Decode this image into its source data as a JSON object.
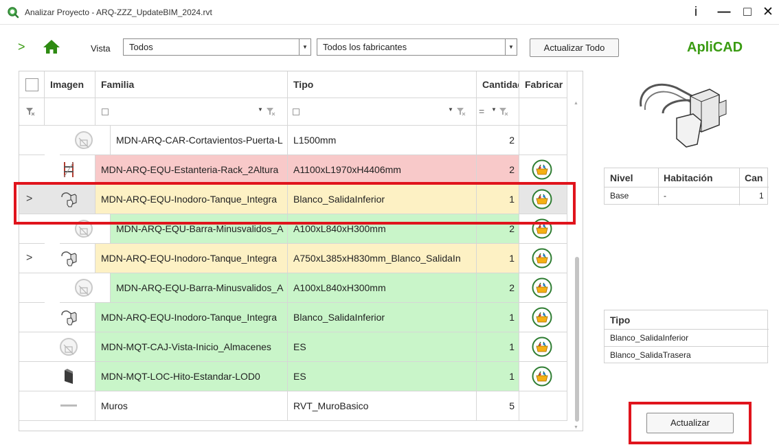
{
  "window": {
    "title": "Analizar Proyecto - ARQ-ZZZ_UpdateBIM_2024.rvt",
    "info_glyph": "i",
    "minimize_glyph": "—",
    "maximize_glyph": "□",
    "close_glyph": "✕"
  },
  "toolbar": {
    "expand_glyph": ">",
    "vista_label": "Vista",
    "vista_value": "Todos",
    "fabricantes_value": "Todos los fabricantes",
    "update_all_label": "Actualizar Todo",
    "brand": "ApliCAD",
    "accent": "#3a9b12"
  },
  "grid": {
    "columns": [
      "Imagen",
      "Familia",
      "Tipo",
      "Cantidad",
      "Fabricar"
    ],
    "filter_eq": "=",
    "rows": [
      {
        "familia": "MDN-ARQ-CAR-Cortavientos-Puerta-L",
        "tipo": "L1500mm",
        "cantidad": "2",
        "status": "none",
        "image": "no-image-icon",
        "indent": true,
        "fabricar": false
      },
      {
        "familia": "MDN-ARQ-EQU-Estanteria-Rack_2Altura",
        "tipo": "A1100xL1970xH4406mm",
        "cantidad": "2",
        "status": "red",
        "image": "rack-thumbnail",
        "indent": false,
        "fabricar": true
      },
      {
        "familia": "MDN-ARQ-EQU-Inodoro-Tanque_Integra",
        "tipo": "Blanco_SalidaInferior",
        "cantidad": "1",
        "status": "yellow",
        "image": "toilet-thumbnail",
        "indent": false,
        "expander": true,
        "selected": true,
        "fabricar": true
      },
      {
        "familia": "MDN-ARQ-EQU-Barra-Minusvalidos_A",
        "tipo": "A100xL840xH300mm",
        "cantidad": "2",
        "status": "green",
        "image": "no-image-icon",
        "indent": true,
        "fabricar": true
      },
      {
        "familia": "MDN-ARQ-EQU-Inodoro-Tanque_Integra",
        "tipo": "A750xL385xH830mm_Blanco_SalidaIn",
        "cantidad": "1",
        "status": "yellow",
        "image": "toilet-thumbnail",
        "indent": false,
        "expander": true,
        "fabricar": true
      },
      {
        "familia": "MDN-ARQ-EQU-Barra-Minusvalidos_A",
        "tipo": "A100xL840xH300mm",
        "cantidad": "2",
        "status": "green",
        "image": "no-image-icon",
        "indent": true,
        "fabricar": true
      },
      {
        "familia": "MDN-ARQ-EQU-Inodoro-Tanque_Integra",
        "tipo": "Blanco_SalidaInferior",
        "cantidad": "1",
        "status": "green",
        "image": "toilet-thumbnail",
        "indent": false,
        "fabricar": true
      },
      {
        "familia": "MDN-MQT-CAJ-Vista-Inicio_Almacenes",
        "tipo": "ES",
        "cantidad": "1",
        "status": "green",
        "image": "no-image-icon",
        "indent": false,
        "fabricar": true
      },
      {
        "familia": "MDN-MQT-LOC-Hito-Estandar-LOD0",
        "tipo": "ES",
        "cantidad": "1",
        "status": "green",
        "image": "marker-thumbnail",
        "indent": false,
        "fabricar": true
      },
      {
        "familia": "Muros",
        "tipo": "RVT_MuroBasico",
        "cantidad": "5",
        "status": "none",
        "image": "wall-thumbnail",
        "indent": false,
        "fabricar": false
      }
    ]
  },
  "status_colors": {
    "red": "#f8c9c9",
    "yellow": "#fdf1c4",
    "green": "#c9f5c9",
    "none": "#ffffff",
    "highlight": "#e0141c"
  },
  "level_table": {
    "headers": [
      "Nivel",
      "Habitación",
      "Can"
    ],
    "rows": [
      [
        "Base",
        "-",
        "1"
      ]
    ]
  },
  "type_table": {
    "header": "Tipo",
    "rows": [
      "Blanco_SalidaInferior",
      "Blanco_SalidaTrasera"
    ]
  },
  "update_button": {
    "label": "Actualizar"
  }
}
